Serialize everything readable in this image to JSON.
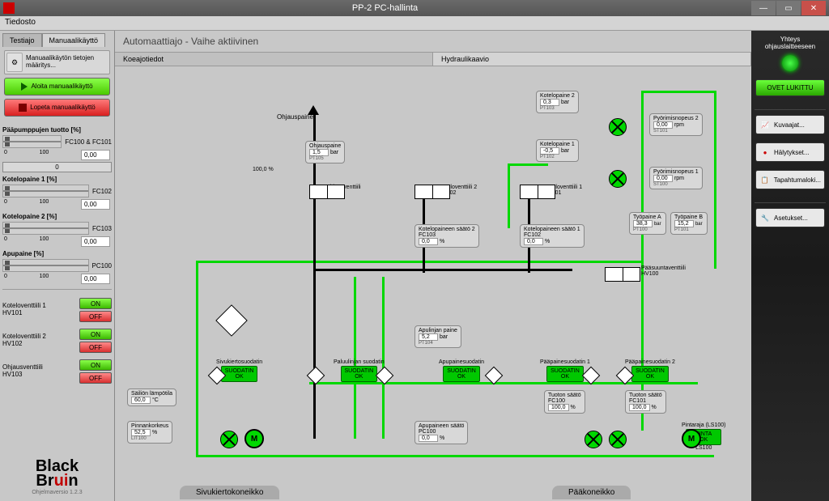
{
  "window": {
    "title": "PP-2 PC-hallinta",
    "menu": "Tiedosto"
  },
  "left": {
    "tab_test": "Testiajo",
    "tab_manual": "Manuaalikäyttö",
    "settings_btn": "Manuaalikäytön tietojen määritys...",
    "start_btn": "Aloita manuaalikäyttö",
    "stop_btn": "Lopeta manuaalikäyttö",
    "pump_label": "Pääpumppujen tuotto [%]",
    "fc100_101": "FC100 & FC101",
    "fc100_val": "0,00",
    "zero_btn": "0",
    "kp1_label": "Kotelopaine 1 [%]",
    "fc102": "FC102",
    "fc102_val": "0,00",
    "kp2_label": "Kotelopaine 2 [%]",
    "fc103": "FC103",
    "fc103_val": "0,00",
    "apu_label": "Apupaine [%]",
    "pc100": "PC100",
    "pc100_val": "0,00",
    "valve1": "Koteloventtiili 1\nHV101",
    "valve2": "Koteloventtiili 2\nHV102",
    "valve3": "Ohjausventtiili\nHV103",
    "on": "ON",
    "off": "OFF",
    "logo1": "Black",
    "logo2": "Br",
    "logo2b": "u",
    "logo2c": "i",
    "logo2d": "n",
    "version": "Ohjelmaversio 1.2.3"
  },
  "center": {
    "header": "Automaattiajo - Vaihe aktiivinen",
    "tab1": "Koeajotiedot",
    "tab2": "Hydraulikaavio",
    "ohjauspaine": "Ohjauspaine",
    "op_box": {
      "label": "Ohjauspaine",
      "val": "1,5",
      "unit": "bar",
      "tag": "PT105"
    },
    "range": "100,0 %",
    "hv103": "Ohjausventtiili\nHV103",
    "hv102": "Koteloventtiili 2\nHV102",
    "hv101": "Koteloventtiili 1\nHV101",
    "hv100": "Pääsuuntaventtiili\nHV100",
    "kps2": {
      "label": "Kotelopaineen säätö 2",
      "fc": "FC103",
      "val": "0,0",
      "unit": "%"
    },
    "kps1": {
      "label": "Kotelopaineen säätö 1",
      "fc": "FC102",
      "val": "0,0",
      "unit": "%"
    },
    "kp2": {
      "label": "Kotelopaine 2",
      "val": "0,3",
      "unit": "bar",
      "tag": "PT103"
    },
    "kp1": {
      "label": "Kotelopaine 1",
      "val": "-0,5",
      "unit": "bar",
      "tag": "PT102"
    },
    "rpm2": {
      "label": "Pyörimisnopeus 2",
      "val": "0,00",
      "unit": "rpm",
      "tag": "ST101"
    },
    "rpm1": {
      "label": "Pyörimisnopeus 1",
      "val": "0,00",
      "unit": "rpm",
      "tag": "ST100"
    },
    "wpA": {
      "label": "Työpaine A",
      "val": "38,3",
      "unit": "bar",
      "tag": "PT100"
    },
    "wpB": {
      "label": "Työpaine B",
      "val": "15,2",
      "unit": "bar",
      "tag": "PT101"
    },
    "apulinja": {
      "label": "Apulinjan paine",
      "val": "5,2",
      "unit": "bar",
      "tag": "PT104"
    },
    "sivuk": {
      "label": "Sivukiertosuodatin",
      "ok": "SUODATIN\nOK"
    },
    "paluus": {
      "label": "Paluulinjan suodatin",
      "ok": "SUODATIN\nOK"
    },
    "apus": {
      "label": "Apupainesuodatin",
      "ok": "SUODATIN\nOK"
    },
    "paa1": {
      "label": "Pääpainesuodatin 1",
      "ok": "SUODATIN\nOK"
    },
    "paa2": {
      "label": "Pääpainesuodatin 2",
      "ok": "SUODATIN\nOK"
    },
    "tuot100": {
      "label": "Tuoton säätö",
      "fc": "FC100",
      "val": "100,0",
      "unit": "%"
    },
    "tuot101": {
      "label": "Tuoton säätö",
      "fc": "FC101",
      "val": "100,0",
      "unit": "%"
    },
    "apupc": {
      "label": "Apupaineen säätö",
      "fc": "PC100",
      "val": "0,0",
      "unit": "%"
    },
    "temp": {
      "label": "Säiliön lämpötila",
      "val": "60,0",
      "unit": "°C"
    },
    "level": {
      "label": "Pinnankorkeus",
      "val": "52,5",
      "unit": "%",
      "tag": "LIT100"
    },
    "pinta": {
      "label": "Pintaraja (LS100)",
      "ok": "PINTA\nOK",
      "tag": "LS100"
    },
    "unit1": "Sivukiertokoneikko",
    "unit2": "Pääkoneikko",
    "M": "M"
  },
  "right": {
    "conn": "Yhteys ohjauslaitteeseen",
    "locked": "OVET LUKITTU",
    "charts": "Kuvaajat...",
    "alarms": "Hälytykset...",
    "events": "Tapahtumaloki...",
    "settings": "Asetukset..."
  }
}
